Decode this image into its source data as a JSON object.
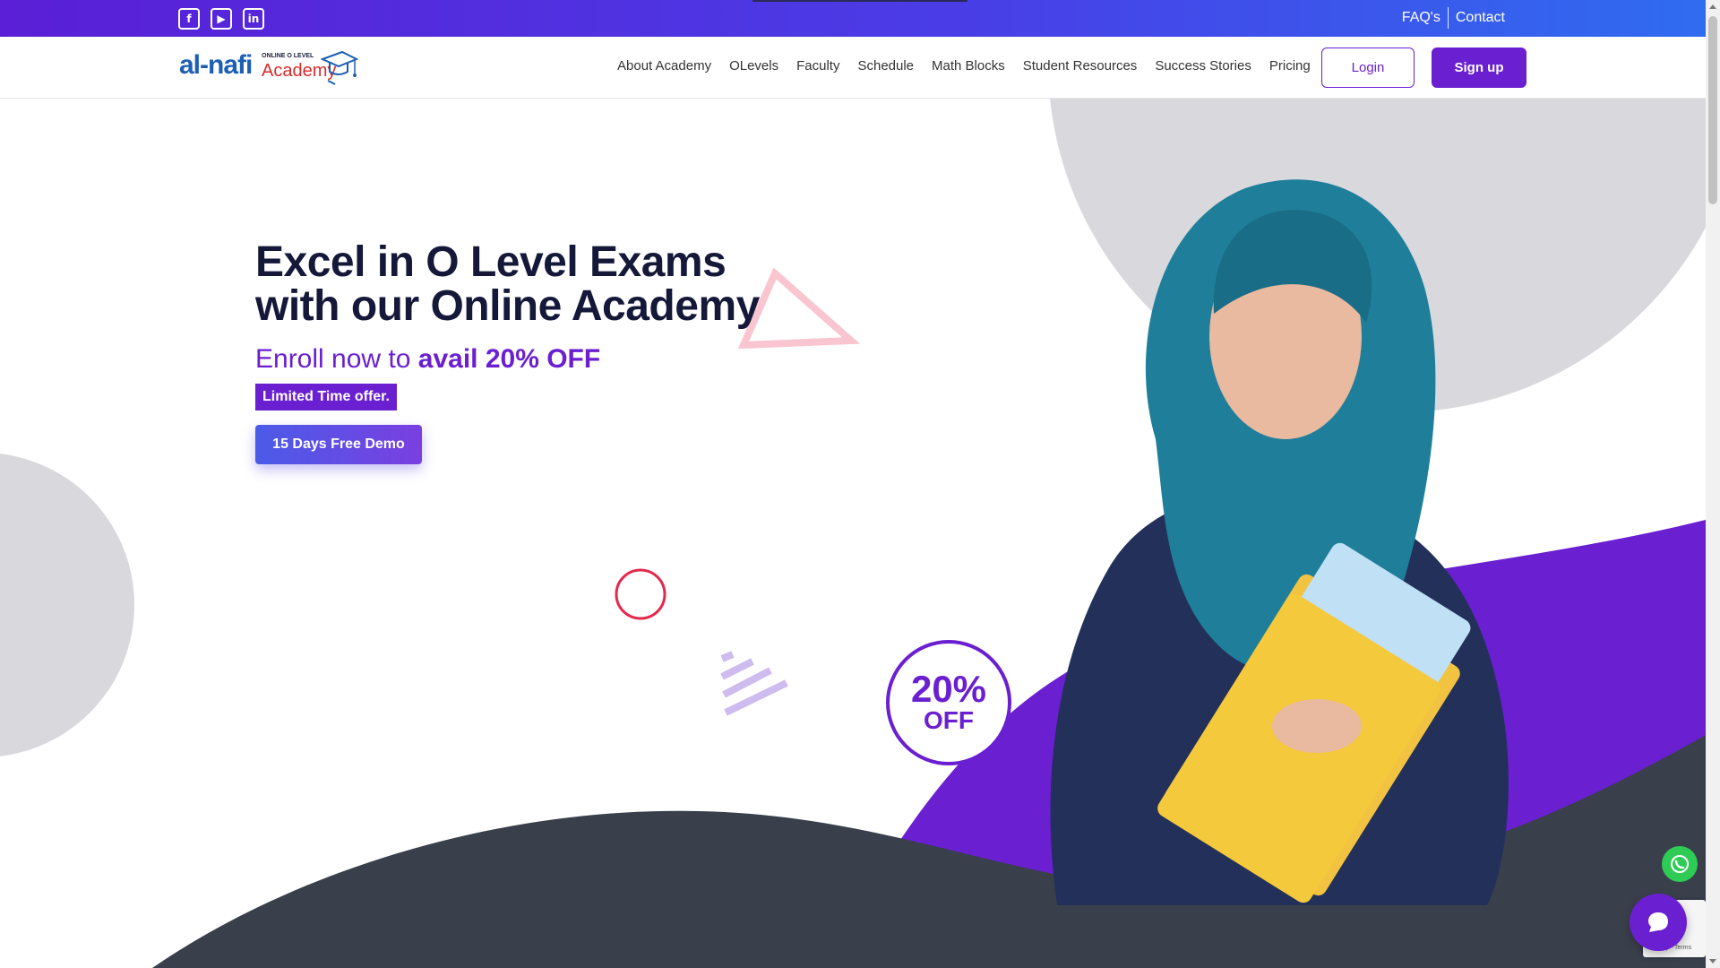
{
  "topbar": {
    "social": [
      {
        "icon": "facebook-icon",
        "glyph": "f"
      },
      {
        "icon": "youtube-icon",
        "glyph": "▶"
      },
      {
        "icon": "linkedin-icon",
        "glyph": "in"
      }
    ],
    "links": {
      "faq": "FAQ's",
      "contact": "Contact"
    }
  },
  "logo": {
    "main": "al-nafi",
    "tagline": "ONLINE O LEVEL",
    "academy": "Academy"
  },
  "nav": {
    "items": [
      "About Academy",
      "OLevels",
      "Faculty",
      "Schedule",
      "Math Blocks",
      "Student Resources",
      "Success Stories",
      "Pricing"
    ],
    "login": "Login",
    "signup": "Sign up"
  },
  "hero": {
    "title_line1": "Excel in O Level Exams",
    "title_line2": "with our Online Academy",
    "sub_prefix": "Enroll now to ",
    "sub_bold": "avail 20% OFF",
    "badge": "Limited Time offer.",
    "cta": "15 Days Free Demo"
  },
  "discount": {
    "pct": "20%",
    "off": "OFF"
  },
  "colors": {
    "brand": "#6a1fd1",
    "dark": "#3a3f4c",
    "grey": "#d9d9dd",
    "accent_red": "#e3284b"
  },
  "recaptcha": {
    "text": "Privacy - Terms"
  }
}
